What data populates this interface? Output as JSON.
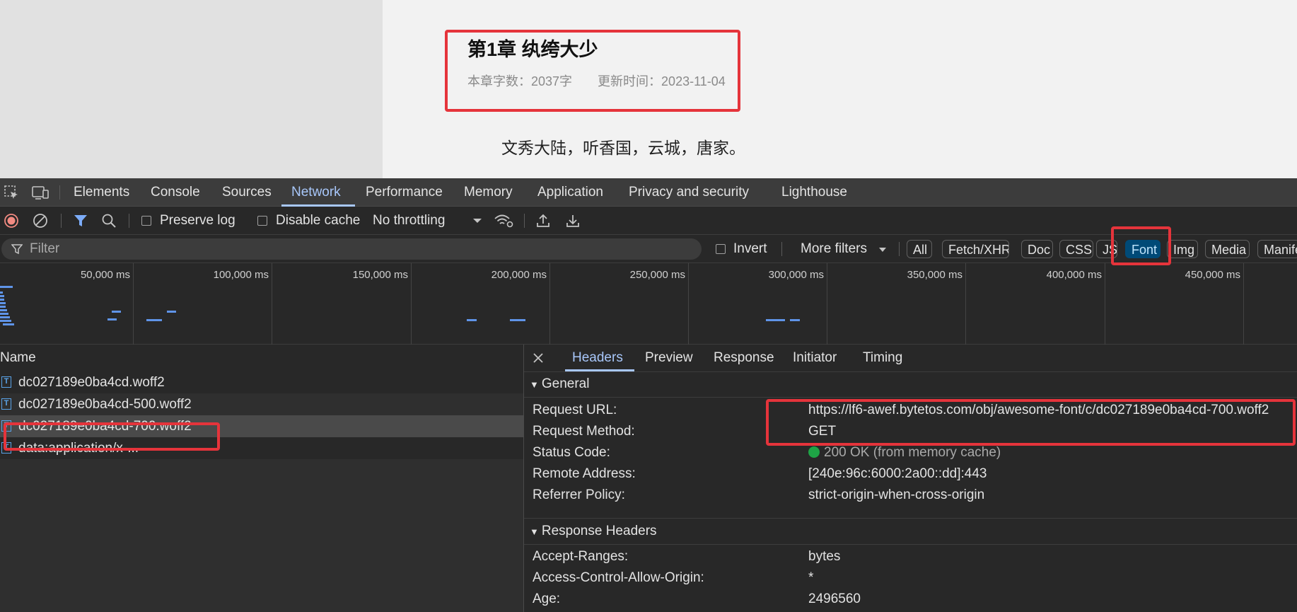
{
  "page": {
    "chapter_title": "第1章 纨绔大少",
    "word_count": "本章字数：2037字",
    "updated": "更新时间：2023-11-04",
    "first_line": "文秀大陆，听香国，云城，唐家。"
  },
  "devtools": {
    "tabs": [
      "Elements",
      "Console",
      "Sources",
      "Network",
      "Performance",
      "Memory",
      "Application",
      "Privacy and security",
      "Lighthouse"
    ],
    "active_tab": "Network",
    "toolbar": {
      "preserve_log": "Preserve log",
      "disable_cache": "Disable cache",
      "throttling": "No throttling"
    },
    "filter": {
      "placeholder": "Filter",
      "invert": "Invert",
      "more_filters": "More filters",
      "types": [
        "All",
        "Fetch/XHR",
        "Doc",
        "CSS",
        "JS",
        "Font",
        "Img",
        "Media",
        "Manife"
      ],
      "active_type": "Font"
    },
    "timeline": {
      "ticks": [
        "50,000 ms",
        "100,000 ms",
        "150,000 ms",
        "200,000 ms",
        "250,000 ms",
        "300,000 ms",
        "350,000 ms",
        "400,000 ms",
        "450,000 ms"
      ]
    },
    "requests": {
      "header": "Name",
      "items": [
        {
          "name": "dc027189e0ba4cd.woff2",
          "icon": "font-file-icon"
        },
        {
          "name": "dc027189e0ba4cd-500.woff2",
          "icon": "font-file-icon"
        },
        {
          "name": "dc027189e0ba4cd-700.woff2",
          "icon": "font-file-icon",
          "selected": true
        },
        {
          "name": "data:application/x-...",
          "icon": "font-file-icon"
        }
      ]
    },
    "details": {
      "tabs": [
        "Headers",
        "Preview",
        "Response",
        "Initiator",
        "Timing"
      ],
      "active_tab": "Headers",
      "general": {
        "title": "General",
        "request_url_k": "Request URL:",
        "request_url_v": "https://lf6-awef.bytetos.com/obj/awesome-font/c/dc027189e0ba4cd-700.woff2",
        "method_k": "Request Method:",
        "method_v": "GET",
        "status_k": "Status Code:",
        "status_v": "200 OK (from memory cache)",
        "remote_k": "Remote Address:",
        "remote_v": "[240e:96c:6000:2a00::dd]:443",
        "referrer_k": "Referrer Policy:",
        "referrer_v": "strict-origin-when-cross-origin"
      },
      "response_headers": {
        "title": "Response Headers",
        "accept_ranges_k": "Accept-Ranges:",
        "accept_ranges_v": "bytes",
        "acao_k": "Access-Control-Allow-Origin:",
        "acao_v": "*",
        "age_k": "Age:",
        "age_v": "2496560"
      }
    },
    "colors": {
      "accent": "#a8c7fa",
      "highlight_box": "#e5343b",
      "status_ok": "#1ea446",
      "waterfall_bar": "#5f94e8"
    }
  }
}
